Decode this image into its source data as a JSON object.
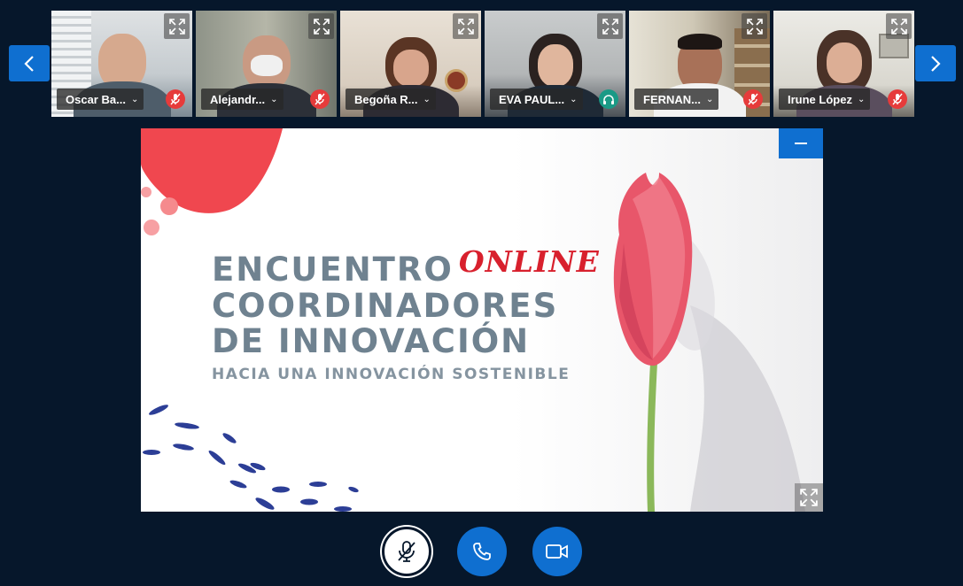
{
  "participants": [
    {
      "name": "Oscar Ba...",
      "status": "muted"
    },
    {
      "name": "Alejandr...",
      "status": "muted"
    },
    {
      "name": "Begoña R...",
      "status": "none"
    },
    {
      "name": "EVA PAUL...",
      "status": "audio"
    },
    {
      "name": "FERNAN...",
      "status": "muted"
    },
    {
      "name": "Irune López",
      "status": "muted"
    }
  ],
  "slide": {
    "title_line1": "ENCUENTRO",
    "title_online": "ONLINE",
    "title_line2": "COORDINADORES",
    "title_line3": "DE INNOVACIÓN",
    "subtitle": "HACIA UNA INNOVACIÓN SOSTENIBLE"
  },
  "colors": {
    "background": "#06172b",
    "accent_blue": "#0f6fd0",
    "muted_red": "#e63b3b",
    "audio_teal": "#1a9a86",
    "slide_text": "#6f8290",
    "online_red": "#d8202d"
  },
  "controls": {
    "mic_icon": "mic-off-icon",
    "hangup_icon": "phone-icon",
    "video_icon": "camera-icon"
  }
}
